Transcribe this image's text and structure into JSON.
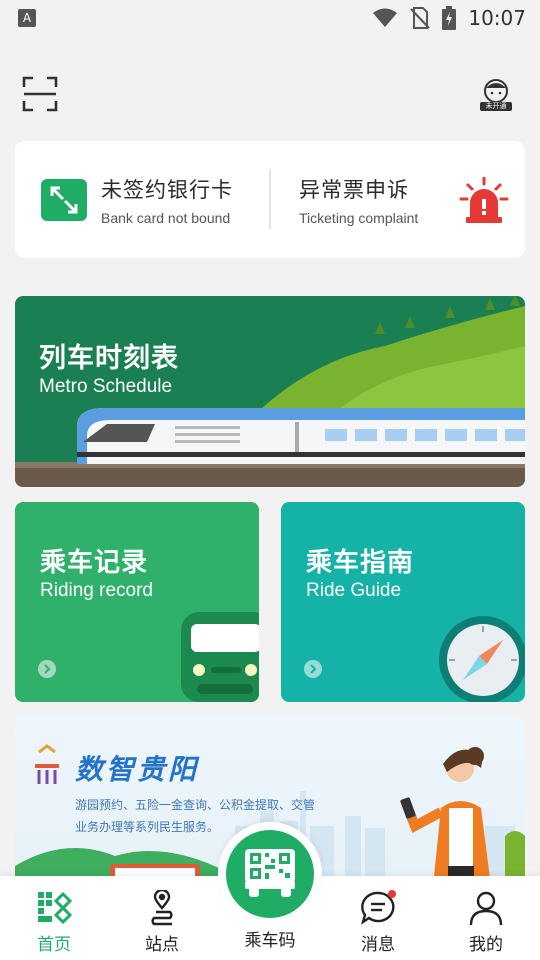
{
  "status_bar": {
    "notification_icon": "A",
    "time": "10:07",
    "icons": [
      "wifi-icon",
      "no-sim-icon",
      "battery-charging-icon"
    ]
  },
  "header": {
    "scan_icon": "scan-icon",
    "avatar_icon": "avatar-icon",
    "avatar_badge": "未开通"
  },
  "quick_card": {
    "bank": {
      "title": "未签约银行卡",
      "subtitle": "Bank card not bound",
      "icon": "bank-card-icon"
    },
    "complaint": {
      "title": "异常票申诉",
      "subtitle": "Ticketing complaint",
      "icon": "alarm-icon"
    }
  },
  "schedule_banner": {
    "title": "列车时刻表",
    "subtitle": "Metro Schedule"
  },
  "tiles": {
    "ride_record": {
      "title": "乘车记录",
      "subtitle": "Riding record"
    },
    "ride_guide": {
      "title": "乘车指南",
      "subtitle": "Ride Guide"
    }
  },
  "promo_banner": {
    "title": "数智贵阳",
    "desc_line1": "游园预约、五险一金查询、公积金提取、交管",
    "desc_line2": "业务办理等系列民生服务。"
  },
  "bottom_nav": {
    "items": [
      {
        "label": "首页",
        "icon": "home-icon"
      },
      {
        "label": "站点",
        "icon": "station-icon"
      },
      {
        "label": "乘车码",
        "icon": "qr-bus-icon"
      },
      {
        "label": "消息",
        "icon": "message-icon"
      },
      {
        "label": "我的",
        "icon": "profile-icon"
      }
    ]
  },
  "colors": {
    "primary_green": "#1fad66",
    "teal": "#15b2a7",
    "promo_blue": "#2473c9",
    "alert_red": "#e53935"
  }
}
